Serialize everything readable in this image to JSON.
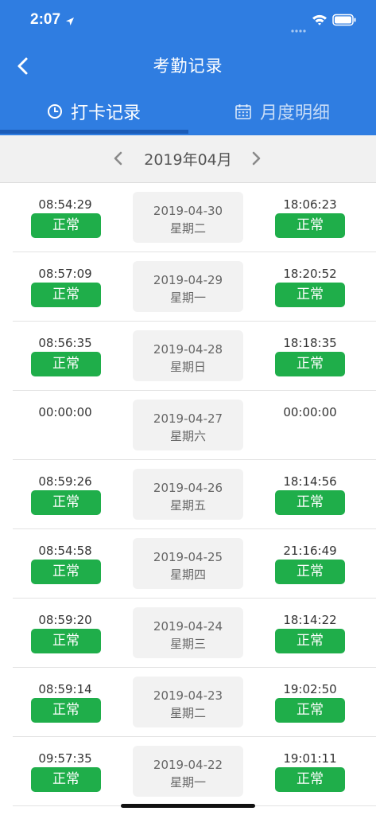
{
  "status_bar": {
    "time": "2:07"
  },
  "nav": {
    "title": "考勤记录"
  },
  "tabs": [
    {
      "label": "打卡记录",
      "icon": "clock-icon",
      "active": true
    },
    {
      "label": "月度明细",
      "icon": "calendar-icon",
      "active": false
    }
  ],
  "month": {
    "label": "2019年04月"
  },
  "colors": {
    "header": "#2f7de1",
    "badge": "#1fae4a"
  },
  "records": [
    {
      "in_time": "08:54:29",
      "in_status": "正常",
      "date": "2019-04-30",
      "weekday": "星期二",
      "out_time": "18:06:23",
      "out_status": "正常"
    },
    {
      "in_time": "08:57:09",
      "in_status": "正常",
      "date": "2019-04-29",
      "weekday": "星期一",
      "out_time": "18:20:52",
      "out_status": "正常"
    },
    {
      "in_time": "08:56:35",
      "in_status": "正常",
      "date": "2019-04-28",
      "weekday": "星期日",
      "out_time": "18:18:35",
      "out_status": "正常"
    },
    {
      "in_time": "00:00:00",
      "in_status": "",
      "date": "2019-04-27",
      "weekday": "星期六",
      "out_time": "00:00:00",
      "out_status": ""
    },
    {
      "in_time": "08:59:26",
      "in_status": "正常",
      "date": "2019-04-26",
      "weekday": "星期五",
      "out_time": "18:14:56",
      "out_status": "正常"
    },
    {
      "in_time": "08:54:58",
      "in_status": "正常",
      "date": "2019-04-25",
      "weekday": "星期四",
      "out_time": "21:16:49",
      "out_status": "正常"
    },
    {
      "in_time": "08:59:20",
      "in_status": "正常",
      "date": "2019-04-24",
      "weekday": "星期三",
      "out_time": "18:14:22",
      "out_status": "正常"
    },
    {
      "in_time": "08:59:14",
      "in_status": "正常",
      "date": "2019-04-23",
      "weekday": "星期二",
      "out_time": "19:02:50",
      "out_status": "正常"
    },
    {
      "in_time": "09:57:35",
      "in_status": "正常",
      "date": "2019-04-22",
      "weekday": "星期一",
      "out_time": "19:01:11",
      "out_status": "正常"
    }
  ]
}
